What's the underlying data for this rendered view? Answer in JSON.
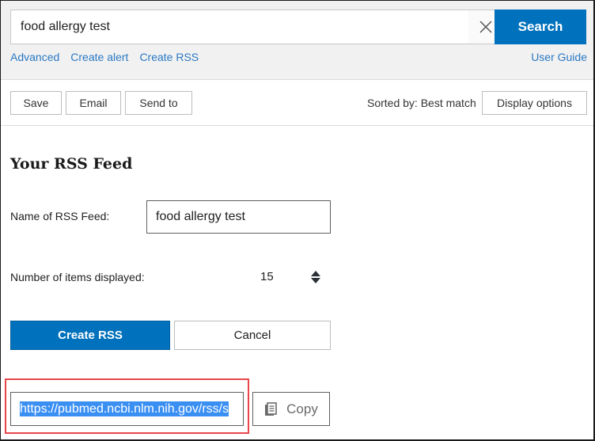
{
  "search": {
    "query": "food allergy test",
    "clear_icon": "close-icon",
    "button_label": "Search",
    "links": [
      "Advanced",
      "Create alert",
      "Create RSS"
    ],
    "user_guide": "User Guide"
  },
  "toolbar": {
    "save_label": "Save",
    "email_label": "Email",
    "send_to_label": "Send to",
    "sorted_by": "Sorted by: Best match",
    "display_options_label": "Display options"
  },
  "rss_form": {
    "heading": "Your RSS Feed",
    "name_label": "Name of RSS Feed:",
    "name_value": "food allergy test",
    "items_label": "Number of items displayed:",
    "items_value": "15",
    "spinner_icon": "sort-updown-icon",
    "create_label": "Create RSS",
    "cancel_label": "Cancel",
    "feed_url": "https://pubmed.ncbi.nlm.nih.gov/rss/s",
    "copy_label": "Copy",
    "copy_icon": "clipboard-icon"
  },
  "colors": {
    "primary": "#0071bc",
    "link": "#2a79c4",
    "highlight": "#e8464b",
    "selection": "#3a8ff3"
  }
}
